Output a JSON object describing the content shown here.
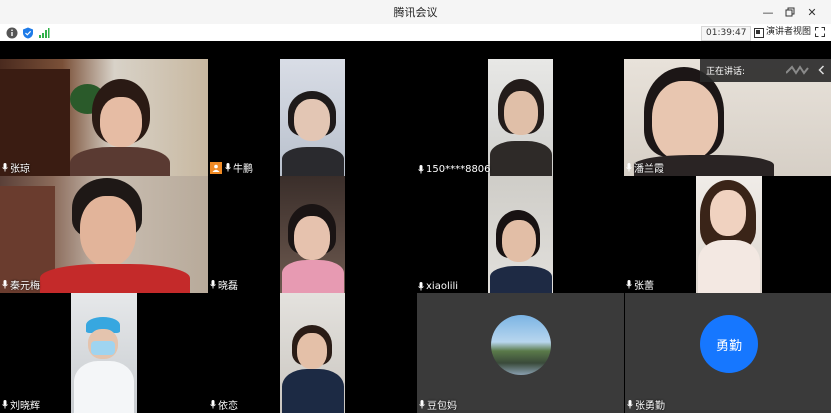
{
  "window": {
    "title": "腾讯会议"
  },
  "toolbar": {
    "time": "01:39:47",
    "speaker_view_label": "演讲者视图"
  },
  "speaking": {
    "label": "正在讲话:"
  },
  "participants": [
    {
      "name": "张琼"
    },
    {
      "name": "牛鹏"
    },
    {
      "name": "150****8806"
    },
    {
      "name": "潘兰霞"
    },
    {
      "name": "秦元梅"
    },
    {
      "name": "晓磊"
    },
    {
      "name": "xiaolili"
    },
    {
      "name": "张蕾"
    },
    {
      "name": "刘晓辉"
    },
    {
      "name": "依恋"
    },
    {
      "name": "豆包妈"
    },
    {
      "name": "张勇勤",
      "avatar_text": "勇勤",
      "avatar_color": "#1677ff"
    }
  ],
  "colors": {
    "panel_gray": "#3a3a3a",
    "accent_blue": "#1677ff",
    "host_orange": "#f08a24"
  }
}
